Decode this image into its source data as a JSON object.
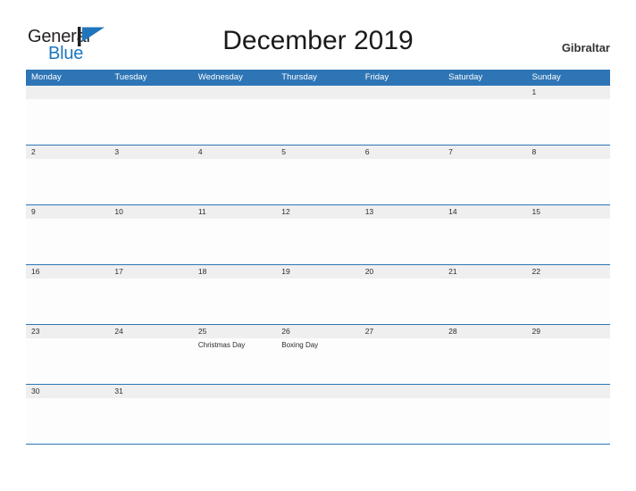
{
  "brand": {
    "name_part1": "General",
    "name_part2": "Blue",
    "mark": "triangle-flag-icon",
    "color_dark": "#231f20",
    "color_blue": "#1f76bc"
  },
  "header": {
    "title": "December 2019",
    "country": "Gibraltar"
  },
  "colors": {
    "header_blue": "#2e75b6",
    "date_band_grey": "#efefef",
    "divider_blue": "#2e75b6",
    "cell_white": "#fdfdfd",
    "text_dark": "#2b2b2b"
  },
  "calendar": {
    "month": "December",
    "year": "2019",
    "weekdays": [
      "Monday",
      "Tuesday",
      "Wednesday",
      "Thursday",
      "Friday",
      "Saturday",
      "Sunday"
    ],
    "weeks": [
      {
        "days": [
          {
            "date": "",
            "events": []
          },
          {
            "date": "",
            "events": []
          },
          {
            "date": "",
            "events": []
          },
          {
            "date": "",
            "events": []
          },
          {
            "date": "",
            "events": []
          },
          {
            "date": "",
            "events": []
          },
          {
            "date": "1",
            "events": []
          }
        ]
      },
      {
        "days": [
          {
            "date": "2",
            "events": []
          },
          {
            "date": "3",
            "events": []
          },
          {
            "date": "4",
            "events": []
          },
          {
            "date": "5",
            "events": []
          },
          {
            "date": "6",
            "events": []
          },
          {
            "date": "7",
            "events": []
          },
          {
            "date": "8",
            "events": []
          }
        ]
      },
      {
        "days": [
          {
            "date": "9",
            "events": []
          },
          {
            "date": "10",
            "events": []
          },
          {
            "date": "11",
            "events": []
          },
          {
            "date": "12",
            "events": []
          },
          {
            "date": "13",
            "events": []
          },
          {
            "date": "14",
            "events": []
          },
          {
            "date": "15",
            "events": []
          }
        ]
      },
      {
        "days": [
          {
            "date": "16",
            "events": []
          },
          {
            "date": "17",
            "events": []
          },
          {
            "date": "18",
            "events": []
          },
          {
            "date": "19",
            "events": []
          },
          {
            "date": "20",
            "events": []
          },
          {
            "date": "21",
            "events": []
          },
          {
            "date": "22",
            "events": []
          }
        ]
      },
      {
        "days": [
          {
            "date": "23",
            "events": []
          },
          {
            "date": "24",
            "events": []
          },
          {
            "date": "25",
            "events": [
              "Christmas Day"
            ]
          },
          {
            "date": "26",
            "events": [
              "Boxing Day"
            ]
          },
          {
            "date": "27",
            "events": []
          },
          {
            "date": "28",
            "events": []
          },
          {
            "date": "29",
            "events": []
          }
        ]
      },
      {
        "days": [
          {
            "date": "30",
            "events": []
          },
          {
            "date": "31",
            "events": []
          },
          {
            "date": "",
            "events": []
          },
          {
            "date": "",
            "events": []
          },
          {
            "date": "",
            "events": []
          },
          {
            "date": "",
            "events": []
          },
          {
            "date": "",
            "events": []
          }
        ]
      }
    ]
  }
}
